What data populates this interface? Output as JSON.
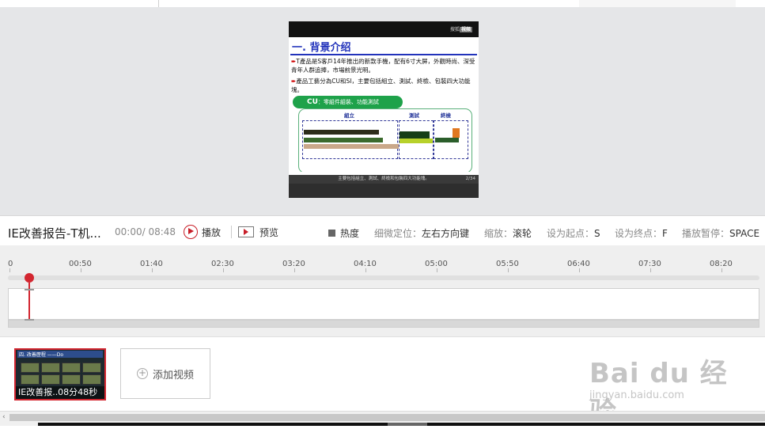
{
  "slide": {
    "logo_text": "搜狐",
    "logo_badge": "視頻",
    "title": "一. 背景介绍",
    "bullet1": "T產品是S客戶14年推出的新款手機，配有6寸大屏，外觀時尚、深受青年人群追捧，市場前景光明。",
    "bullet2": "產品工藝分為CU和SI，主要包括組立、測試、終檢、包裝四大功能塊。",
    "pill_bold": "CU",
    "pill_text": "：零組件組裝、功能測試",
    "labels": [
      "組立",
      "測試",
      "終檢"
    ],
    "footer": "主要包括組立、測試、終檢和包裝四大功能塊。",
    "page": "2/34"
  },
  "info": {
    "video_name": "IE改善报告-T机...",
    "current_time": "00:00",
    "duration": "/ 08:48",
    "play_label": "播放",
    "preview_label": "预览",
    "heat_label": "热度",
    "hints": [
      {
        "label": "细微定位：",
        "key": "左右方向键"
      },
      {
        "label": "缩放：",
        "key": "滚轮"
      },
      {
        "label": "设为起点：",
        "key": "S"
      },
      {
        "label": "设为终点：",
        "key": "F"
      },
      {
        "label": "播放暂停：",
        "key": "SPACE"
      }
    ]
  },
  "ruler": {
    "ticks": [
      "0",
      "00:50",
      "01:40",
      "02:30",
      "03:20",
      "04:10",
      "05:00",
      "05:50",
      "06:40",
      "07:30",
      "08:20"
    ],
    "playhead_seconds": 0
  },
  "clips": {
    "thumb_title": "四. 改善歷程 ——Do",
    "thumb_caption": "IE改善报..08分48秒",
    "add_label": "添加视频"
  },
  "watermark": {
    "brand": "Bai du 经验",
    "url": "jingyan.baidu.com"
  },
  "colors": {
    "accent": "#d32630",
    "slide_title": "#2233bb",
    "pill_green": "#1ea24a"
  }
}
